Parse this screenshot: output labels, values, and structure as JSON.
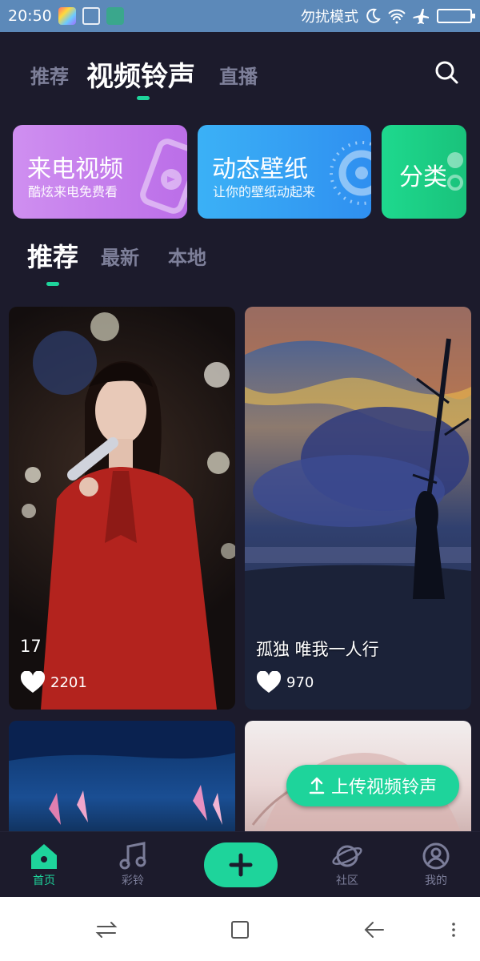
{
  "status_bar": {
    "time": "20:50",
    "right_text": "勿扰模式",
    "icons": [
      "moon-icon",
      "wifi-icon",
      "airplane-icon",
      "battery-icon"
    ]
  },
  "top_tabs": [
    {
      "label": "推荐"
    },
    {
      "label": "视频铃声"
    },
    {
      "label": "直播"
    }
  ],
  "feature_cards": [
    {
      "title": "来电视频",
      "subtitle": "酷炫来电免费看"
    },
    {
      "title": "动态壁纸",
      "subtitle": "让你的壁纸动起来"
    },
    {
      "title": "分类"
    }
  ],
  "sub_tabs": [
    {
      "label": "推荐"
    },
    {
      "label": "最新"
    },
    {
      "label": "本地"
    }
  ],
  "videos": [
    {
      "title": "17",
      "likes": "2201"
    },
    {
      "title": "孤独  唯我一人行",
      "likes": "970"
    }
  ],
  "upload_button": {
    "label": "上传视频铃声"
  },
  "bottom_nav": [
    {
      "label": "首页"
    },
    {
      "label": "彩铃"
    },
    {
      "label": "社区"
    },
    {
      "label": "我的"
    }
  ],
  "colors": {
    "accent": "#1ed49b",
    "background": "#1c1b2c",
    "status_bar": "#5c89b9"
  }
}
